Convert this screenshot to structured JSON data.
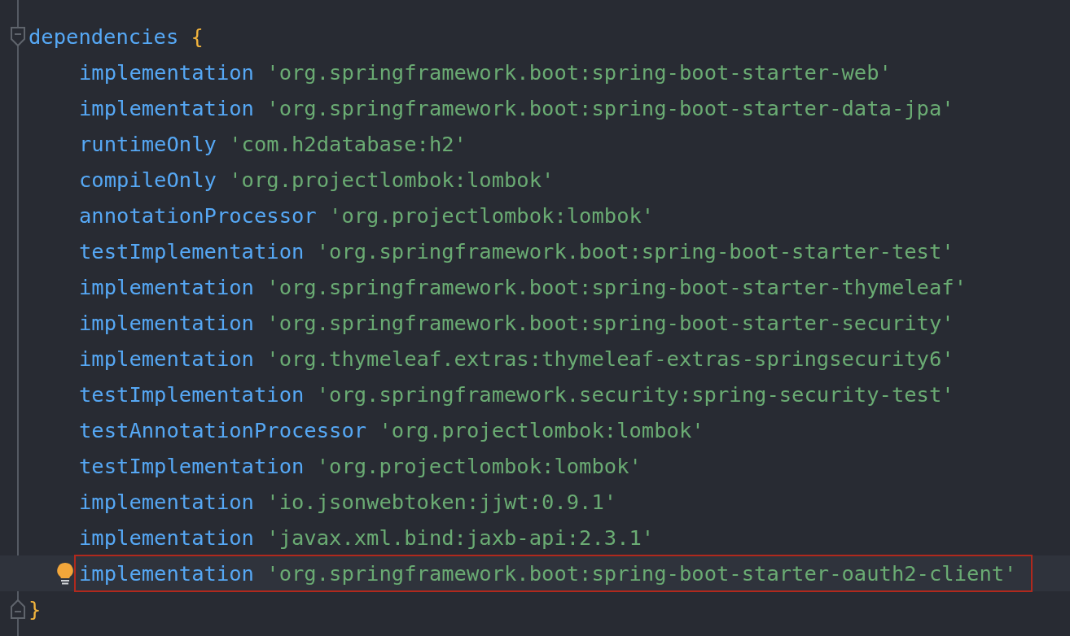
{
  "block": {
    "name": "dependencies",
    "open_brace": "{",
    "close_brace": "}",
    "folded": false
  },
  "lines": [
    {
      "configuration": "implementation",
      "notation": "'org.springframework.boot:spring-boot-starter-web'",
      "current": false,
      "boxed": false
    },
    {
      "configuration": "implementation",
      "notation": "'org.springframework.boot:spring-boot-starter-data-jpa'",
      "current": false,
      "boxed": false
    },
    {
      "configuration": "runtimeOnly",
      "notation": "'com.h2database:h2'",
      "current": false,
      "boxed": false
    },
    {
      "configuration": "compileOnly",
      "notation": "'org.projectlombok:lombok'",
      "current": false,
      "boxed": false
    },
    {
      "configuration": "annotationProcessor",
      "notation": "'org.projectlombok:lombok'",
      "current": false,
      "boxed": false
    },
    {
      "configuration": "testImplementation",
      "notation": "'org.springframework.boot:spring-boot-starter-test'",
      "current": false,
      "boxed": false
    },
    {
      "configuration": "implementation",
      "notation": "'org.springframework.boot:spring-boot-starter-thymeleaf'",
      "current": false,
      "boxed": false
    },
    {
      "configuration": "implementation",
      "notation": "'org.springframework.boot:spring-boot-starter-security'",
      "current": false,
      "boxed": false
    },
    {
      "configuration": "implementation",
      "notation": "'org.thymeleaf.extras:thymeleaf-extras-springsecurity6'",
      "current": false,
      "boxed": false
    },
    {
      "configuration": "testImplementation",
      "notation": "'org.springframework.security:spring-security-test'",
      "current": false,
      "boxed": false
    },
    {
      "configuration": "testAnnotationProcessor",
      "notation": "'org.projectlombok:lombok'",
      "current": false,
      "boxed": false
    },
    {
      "configuration": "testImplementation",
      "notation": "'org.projectlombok:lombok'",
      "current": false,
      "boxed": false
    },
    {
      "configuration": "implementation",
      "notation": "'io.jsonwebtoken:jjwt:0.9.1'",
      "current": false,
      "boxed": false
    },
    {
      "configuration": "implementation",
      "notation": "'javax.xml.bind:jaxb-api:2.3.1'",
      "current": false,
      "boxed": false
    },
    {
      "configuration": "implementation",
      "notation": "'org.springframework.boot:spring-boot-starter-oauth2-client'",
      "current": true,
      "boxed": true
    }
  ]
}
